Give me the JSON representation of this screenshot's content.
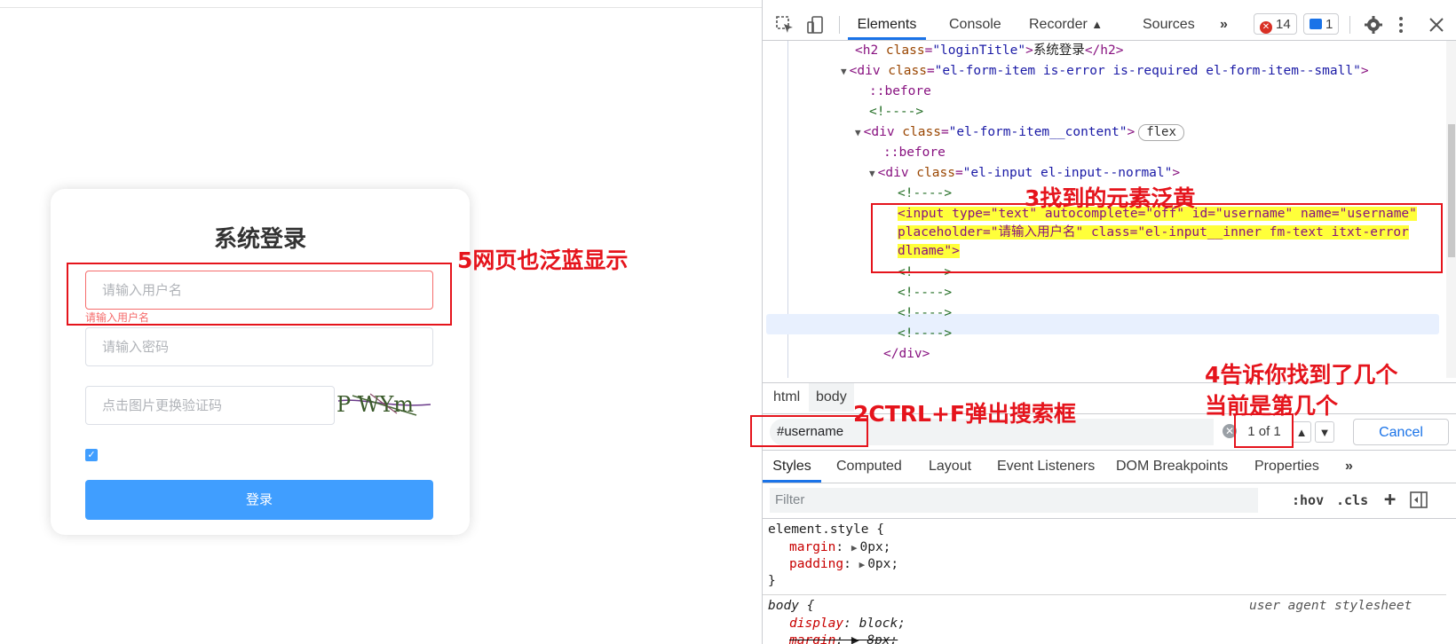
{
  "login": {
    "title": "系统登录",
    "username_placeholder": "请输入用户名",
    "username_error": "请输入用户名",
    "password_placeholder": "请输入密码",
    "captcha_placeholder": "点击图片更换验证码",
    "captcha_text": "P WYm",
    "remember_checked": true,
    "login_button": "登录"
  },
  "annotations": {
    "step5": "5网页也泛蓝显示",
    "step3": "3找到的元素泛黄",
    "step4_line1": "4告诉你找到了几个",
    "step4_line2": "当前是第几个",
    "step2": "2CTRL+F弹出搜索框"
  },
  "devtools": {
    "tabs": [
      "Elements",
      "Console",
      "Recorder",
      "Sources"
    ],
    "more_tabs": "»",
    "errors_count": "14",
    "messages_count": "1",
    "elements": {
      "line1": {
        "tag_open": "<h2 ",
        "attr": "class",
        "val": "\"loginTitle\"",
        "text": "系统登录",
        "tag_close": "</h2>"
      },
      "line2": {
        "attr1": "class",
        "val1": "\"el-form-item is-error is-required el-form-item--small\""
      },
      "line3": "::before",
      "line4": "<!---->",
      "line5": {
        "attr": "class",
        "val": "\"el-form-item__content\"",
        "pill": "flex"
      },
      "line6": "::before",
      "line7": {
        "attr": "class",
        "val": "\"el-input el-input--normal\""
      },
      "line8": "<!---->",
      "input_line1": "<input type=\"text\" autocomplete=\"off\" id=\"username\" name=\"username\"",
      "input_line2": "placeholder=\"请输入用户名\" class=\"el-input__inner fm-text itxt-error",
      "input_line3": "dlname\">",
      "comments": [
        "<!---->",
        "<!---->",
        "<!---->",
        "<!---->"
      ],
      "close_div": "</div>"
    },
    "breadcrumbs": [
      "html",
      "body"
    ],
    "search": {
      "query": "#username",
      "count": "1 of 1",
      "cancel": "Cancel"
    },
    "style_tabs": [
      "Styles",
      "Computed",
      "Layout",
      "Event Listeners",
      "DOM Breakpoints",
      "Properties"
    ],
    "filter_placeholder": "Filter",
    "filter_hov": ":hov",
    "filter_cls": ".cls",
    "rules": {
      "element_style": "element.style {",
      "margin_prop": "margin",
      "margin_val": "0px;",
      "padding_prop": "padding",
      "padding_val": "0px;",
      "close": "}",
      "body_selector": "body {",
      "ua_label": "user agent stylesheet",
      "display_prop": "display",
      "display_val": "block;",
      "margin2_prop": "margin",
      "margin2_val": "8px;"
    }
  },
  "colors": {
    "annotation_red": "#e5141c",
    "primary_blue": "#409eff",
    "error_red": "#f56c6c",
    "search_highlight": "#ffff3a"
  }
}
